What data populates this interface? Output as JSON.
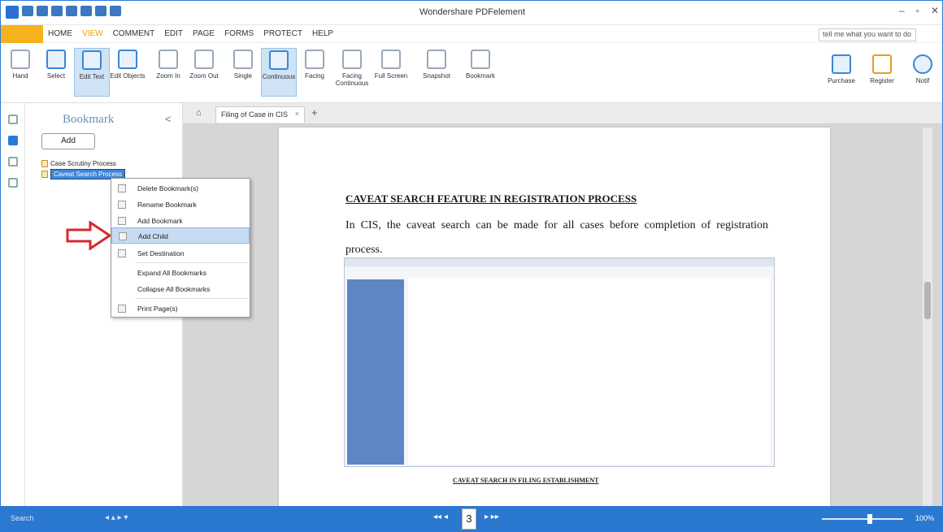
{
  "window": {
    "title": "Wondershare PDFelement"
  },
  "menu": {
    "file": "",
    "items": [
      "HOME",
      "VIEW",
      "COMMENT",
      "EDIT",
      "PAGE",
      "FORMS",
      "PROTECT",
      "HELP"
    ],
    "search_placeholder": "tell me what you want to do"
  },
  "ribbon": {
    "buttons": [
      "Hand",
      "Select",
      "Edit Text",
      "Edit Objects",
      "Zoom In",
      "Zoom Out",
      "Single",
      "Continuous",
      "Facing",
      "Facing Continuous",
      "Full Screen",
      "Snapshot",
      "Bookmark"
    ],
    "right": [
      "Purchase",
      "Register",
      "Notif"
    ]
  },
  "bookmark_panel": {
    "title": "Bookmark",
    "close": "<",
    "add": "Add",
    "items": [
      "Case Scrutiny Process",
      "Caveat Search Process"
    ]
  },
  "tabs": {
    "home": "⌂",
    "doc": "Filing of Case in CIS",
    "close": "×",
    "plus": "+"
  },
  "document": {
    "heading": "CAVEAT SEARCH FEATURE IN REGISTRATION PROCESS",
    "para": "In CIS, the caveat search can be made for all cases before completion of registration process.",
    "caption": "CAVEAT SEARCH IN FILING ESTABLISHMENT"
  },
  "context_menu": [
    "Delete Bookmark(s)",
    "Rename Bookmark",
    "Add Bookmark",
    "Add Child",
    "Set Destination",
    "Expand All Bookmarks",
    "Collapse All Bookmarks",
    "Print Page(s)"
  ],
  "status": {
    "left": "Search",
    "page": "3",
    "zoom": "100%",
    "zoom_level": 0.6
  }
}
